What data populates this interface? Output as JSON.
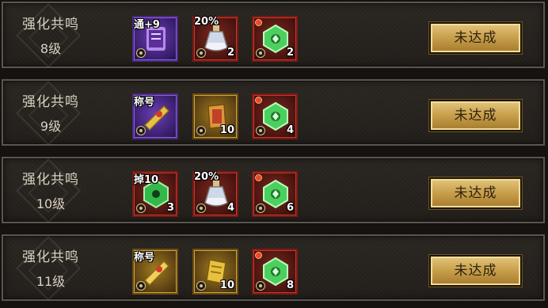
{
  "rows": [
    {
      "title": "强化共鸣",
      "level": "8级",
      "status": "未达成",
      "items": [
        {
          "icon": "purple-scroll-icon",
          "tag": "通+9",
          "count": ""
        },
        {
          "icon": "potion-flask-icon",
          "tag": "20%",
          "count": "2"
        },
        {
          "icon": "green-gem-icon",
          "tag": "",
          "count": "2"
        }
      ]
    },
    {
      "title": "强化共鸣",
      "level": "9级",
      "status": "未达成",
      "items": [
        {
          "icon": "golden-title-scroll-icon",
          "tag": "称号",
          "count": ""
        },
        {
          "icon": "red-scroll-icon",
          "tag": "",
          "count": "10"
        },
        {
          "icon": "green-gem-icon",
          "tag": "",
          "count": "4"
        }
      ]
    },
    {
      "title": "强化共鸣",
      "level": "10级",
      "status": "未达成",
      "items": [
        {
          "icon": "green-drop-gem-icon",
          "tag": "掉10",
          "count": "3"
        },
        {
          "icon": "potion-flask-icon",
          "tag": "20%",
          "count": "4"
        },
        {
          "icon": "green-gem-icon",
          "tag": "",
          "count": "6"
        }
      ]
    },
    {
      "title": "强化共鸣",
      "level": "11级",
      "status": "未达成",
      "items": [
        {
          "icon": "golden-title-scroll-icon",
          "tag": "称号",
          "count": ""
        },
        {
          "icon": "golden-scroll-icon",
          "tag": "",
          "count": "10"
        },
        {
          "icon": "green-gem-icon",
          "tag": "",
          "count": "8"
        }
      ]
    }
  ]
}
